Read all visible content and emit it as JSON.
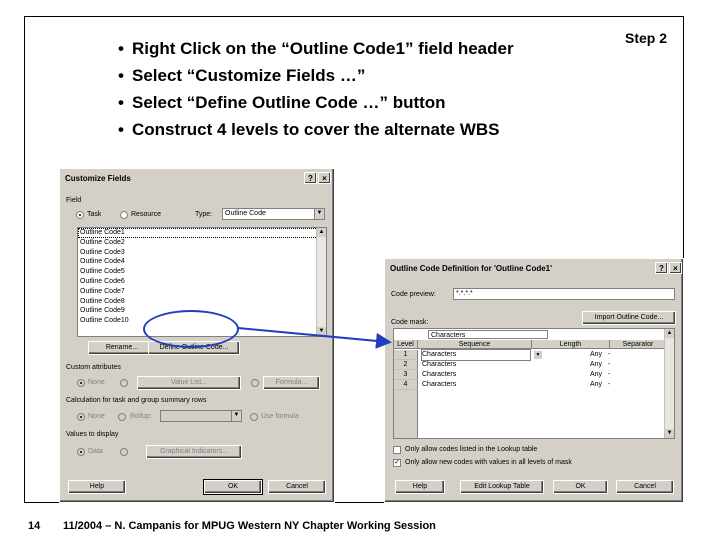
{
  "slide": {
    "bullets": [
      "Right Click on the “Outline Code1” field header",
      "Select “Customize Fields …”",
      "Select “Define Outline Code …” button",
      "Construct 4 levels to cover the alternate WBS"
    ],
    "step_label": "Step 2",
    "page_number": "14",
    "footer": "11/2004 – N. Campanis for MPUG Western NY Chapter Working Session"
  },
  "customize_dialog": {
    "title": "Customize Fields",
    "help_btn": "?",
    "close_btn": "×",
    "field_group_label": "Field",
    "radio_task": "Task",
    "radio_resource": "Resource",
    "type_label": "Type:",
    "type_value": "Outline Code",
    "fields": [
      "Outline Code1",
      "Outline Code2",
      "Outline Code3",
      "Outline Code4",
      "Outline Code5",
      "Outline Code6",
      "Outline Code7",
      "Outline Code8",
      "Outline Code9",
      "Outline Code10"
    ],
    "rename_btn": "Rename...",
    "define_btn": "Define Outline Code...",
    "custom_attributes_label": "Custom attributes",
    "attr_none": "None",
    "value_list_btn": "Value List...",
    "formula_btn": "Formula...",
    "calc_label": "Calculation for task and group summary rows",
    "calc_none": "None",
    "calc_rollup": "Rollup:",
    "calc_formula": "Use formula",
    "values_label": "Values to display",
    "values_data": "Data",
    "graphical_btn": "Graphical Indicators...",
    "help_button": "Help",
    "ok_button": "OK",
    "cancel_button": "Cancel"
  },
  "outline_dialog": {
    "title": "Outline Code Definition for 'Outline Code1'",
    "help_btn": "?",
    "close_btn": "×",
    "code_preview_label": "Code preview:",
    "code_preview_value": "*.*.*.*",
    "code_mask_label": "Code mask:",
    "import_btn": "Import Outline Code...",
    "mask_value": "Characters",
    "columns": [
      "Level",
      "Sequence",
      "Length",
      "Separator"
    ],
    "rows": [
      {
        "level": "1",
        "sequence": "Characters",
        "length": "Any",
        "separator": "-"
      },
      {
        "level": "2",
        "sequence": "Characters",
        "length": "Any",
        "separator": "-"
      },
      {
        "level": "3",
        "sequence": "Characters",
        "length": "Any",
        "separator": "-"
      },
      {
        "level": "4",
        "sequence": "Characters",
        "length": "Any",
        "separator": "-"
      }
    ],
    "lookup_only": "Only allow codes listed in the Lookup table",
    "new_codes_only": "Only allow new codes with values in all levels of mask",
    "help_button": "Help",
    "edit_lookup_button": "Edit Lookup Table",
    "ok_button": "OK",
    "cancel_button": "Cancel"
  },
  "colors": {
    "callout": "#1f3fbf",
    "dialog_face": "#d4d0c8"
  }
}
